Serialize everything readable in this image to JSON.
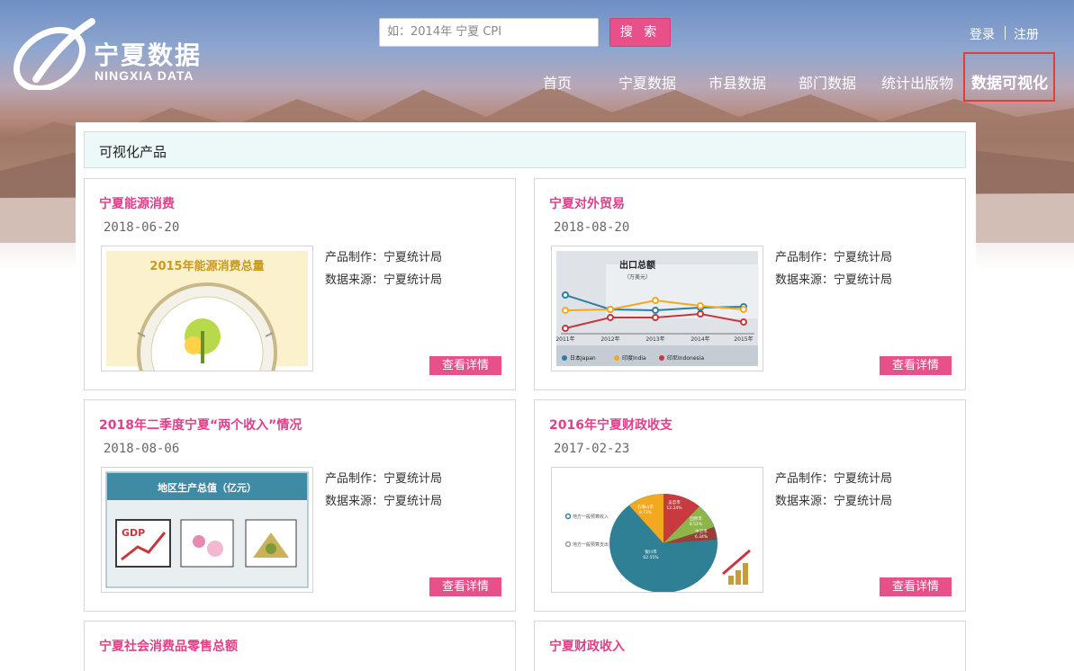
{
  "brand": {
    "name_cn": "宁夏数据",
    "name_en": "NINGXIA DATA",
    "accent": "#e8508a",
    "title_color": "#e0408a"
  },
  "search": {
    "placeholder": "如：2014年 宁夏 CPI",
    "button": "搜 索"
  },
  "auth": {
    "login": "登录",
    "register": "注册"
  },
  "nav": {
    "items": [
      "首页",
      "宁夏数据",
      "市县数据",
      "部门数据",
      "统计出版物"
    ],
    "active": "数据可视化"
  },
  "section": {
    "title": "可视化产品"
  },
  "thumbs": {
    "energy_title": "2015年能源消费总量",
    "trade_title": "出口总额",
    "trade_unit": "（万美元）",
    "trade_years": [
      "2011年",
      "2012年",
      "2013年",
      "2014年",
      "2015年"
    ],
    "trade_legend": [
      "日本Japan",
      "印度India",
      "印尼Indonesia"
    ],
    "gdp_title": "地区生产总值（亿元）",
    "gdp_icon_label": "GDP",
    "pie_legend": [
      "地方一般预算收入",
      "地方一般预算支出"
    ],
    "pie_labels": [
      "银川市",
      "62.55%",
      "石嘴山市",
      "9.73%",
      "吴忠市",
      "12.24%",
      "固原市",
      "8.51%",
      "中卫市",
      "6.34%"
    ]
  },
  "cards": [
    {
      "title": "宁夏能源消费",
      "date": "2018-06-20",
      "producer": "产品制作：宁夏统计局",
      "source": "数据来源：宁夏统计局",
      "button": "查看详情"
    },
    {
      "title": "宁夏对外贸易",
      "date": "2018-08-20",
      "producer": "产品制作：宁夏统计局",
      "source": "数据来源：宁夏统计局",
      "button": "查看详情"
    },
    {
      "title": "2018年二季度宁夏“两个收入”情况",
      "date": "2018-08-06",
      "producer": "产品制作：宁夏统计局",
      "source": "数据来源：宁夏统计局",
      "button": "查看详情"
    },
    {
      "title": "2016年宁夏财政收支",
      "date": "2017-02-23",
      "producer": "产品制作：宁夏统计局",
      "source": "数据来源：宁夏统计局",
      "button": "查看详情"
    },
    {
      "title": "宁夏社会消费品零售总额"
    },
    {
      "title": "宁夏财政收入"
    }
  ]
}
